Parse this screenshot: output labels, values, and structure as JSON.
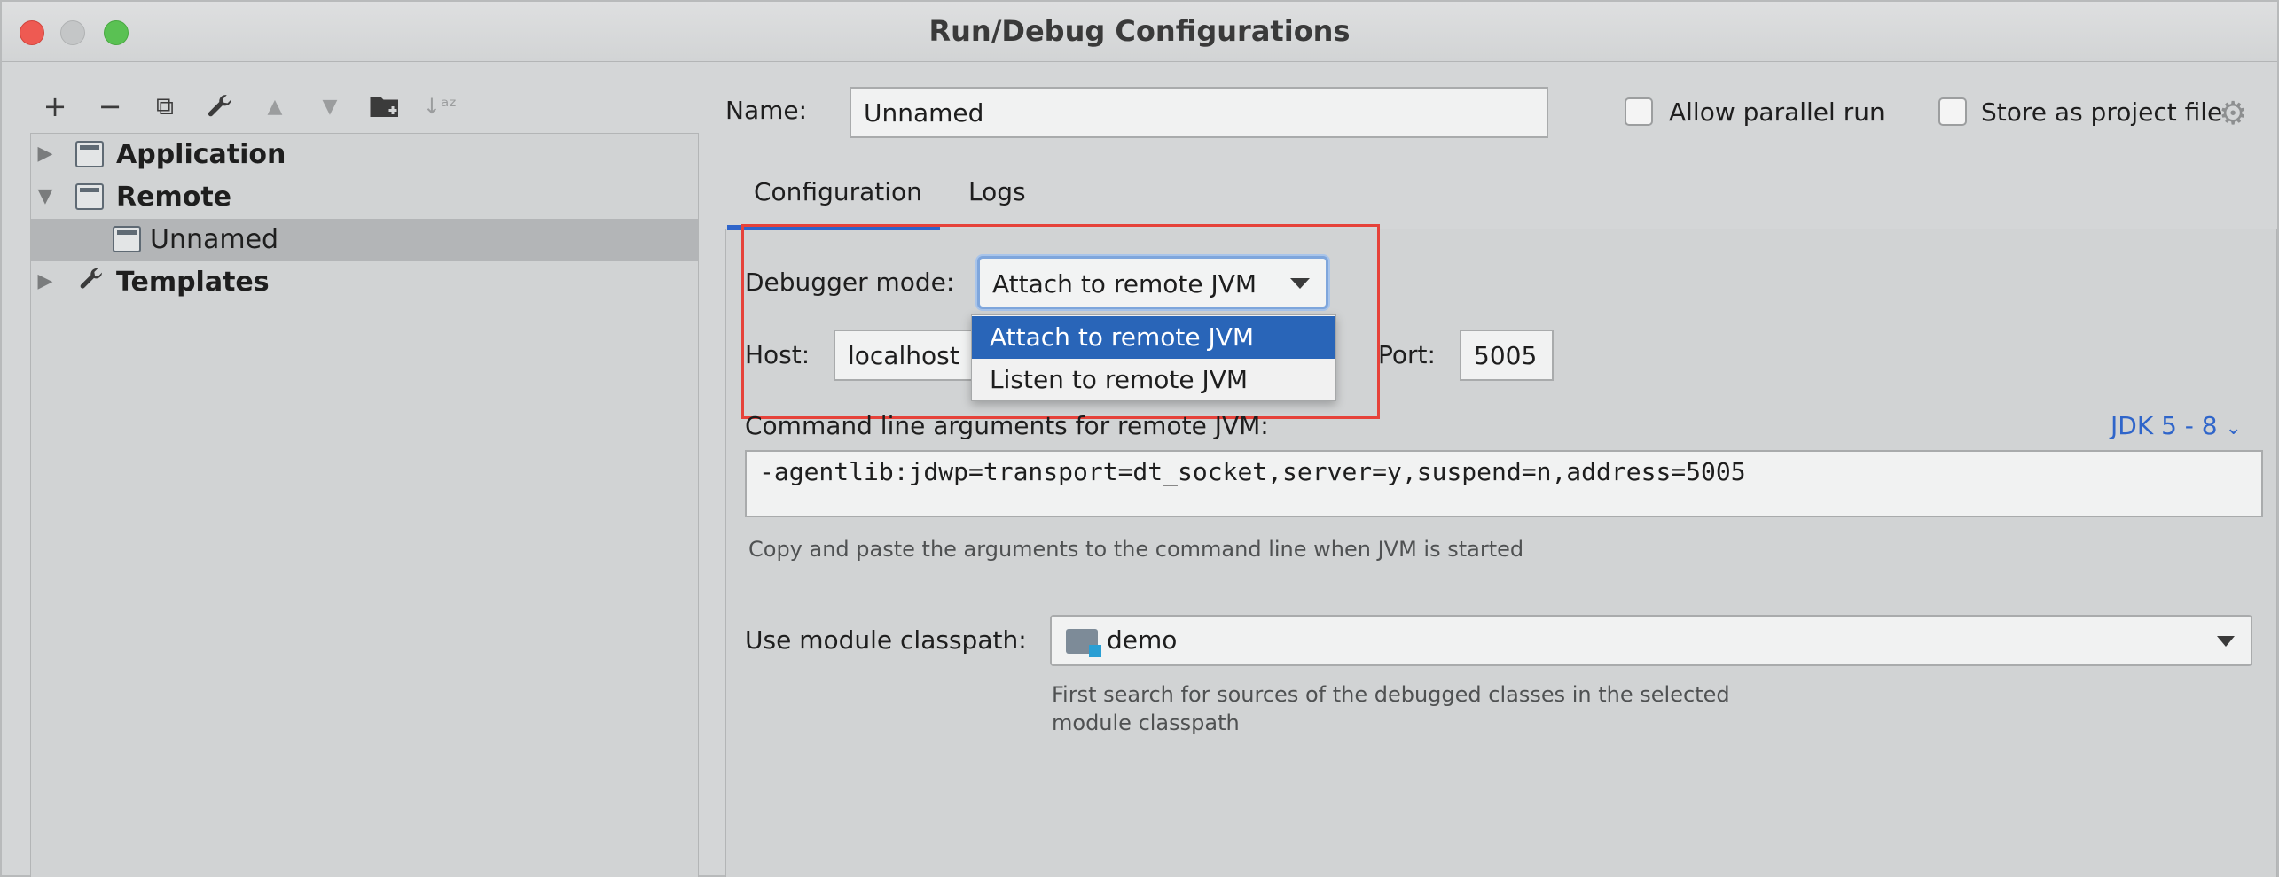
{
  "window": {
    "title": "Run/Debug Configurations"
  },
  "toolbar": {
    "add": "+",
    "remove": "−",
    "copy": "⧉",
    "edit": "🔧",
    "move_up": "▲",
    "move_down": "▼",
    "folder": "📁",
    "sort": "↓ᵃᶻ"
  },
  "tree": {
    "items": [
      {
        "label": "Application",
        "icon": "application-icon",
        "expanded": false
      },
      {
        "label": "Remote",
        "icon": "remote-icon",
        "expanded": true
      },
      {
        "label": "Unnamed",
        "icon": "remote-config-icon",
        "selected": true
      },
      {
        "label": "Templates",
        "icon": "wrench-icon",
        "expanded": false
      }
    ]
  },
  "header": {
    "name_label": "Name:",
    "name_value": "Unnamed",
    "allow_parallel_label": "Allow parallel run",
    "store_project_label": "Store as project file"
  },
  "tabs": [
    {
      "label": "Configuration",
      "active": true
    },
    {
      "label": "Logs",
      "active": false
    }
  ],
  "config": {
    "debugger_mode_label": "Debugger mode:",
    "debugger_mode_value": "Attach to remote JVM",
    "debugger_mode_options": [
      "Attach to remote JVM",
      "Listen to remote JVM"
    ],
    "host_label": "Host:",
    "host_value": "localhost",
    "port_label": "Port:",
    "port_value": "5005",
    "cmd_label": "Command line arguments for remote JVM:",
    "jdk_link": "JDK 5 - 8",
    "cmd_value": "-agentlib:jdwp=transport=dt_socket,server=y,suspend=n,address=5005",
    "cmd_hint": "Copy and paste the arguments to the command line when JVM is started",
    "module_label": "Use module classpath:",
    "module_value": "demo",
    "module_hint_1": "First search for sources of the debugged classes in the selected",
    "module_hint_2": "module classpath"
  },
  "colors": {
    "accent": "#2f65ca",
    "selection": "#2965b8",
    "highlight_box": "#e6423a"
  }
}
